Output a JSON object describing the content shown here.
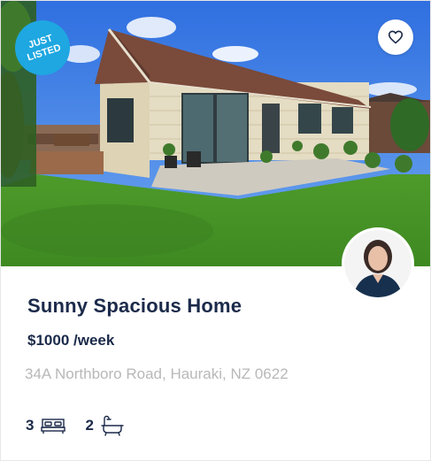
{
  "listing": {
    "badge_line1": "JUST",
    "badge_line2": "LISTED",
    "title": "Sunny Spacious Home",
    "price": "$1000 /week",
    "address": "34A Northboro Road, Hauraki, NZ 0622",
    "bedrooms": "3",
    "bathrooms": "2"
  },
  "icons": {
    "favorite": "heart-outline-icon",
    "bedrooms": "bed-icon",
    "bathrooms": "bathtub-icon"
  },
  "colors": {
    "badge": "#1ea7e1",
    "title": "#1b2a4a",
    "address": "#b8b8b8"
  }
}
